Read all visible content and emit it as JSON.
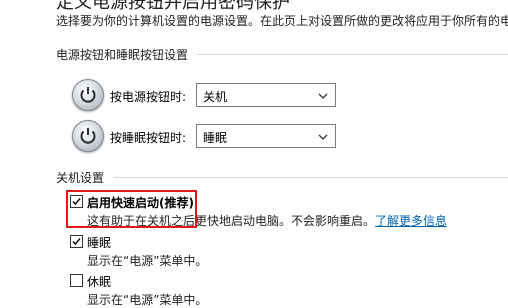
{
  "page": {
    "title": "定义电源按钮并启用密码保护",
    "description": "选择要为你的计算机设置的电源设置。在此页上对设置所做的更改将应用于你所有的电"
  },
  "buttons_section": {
    "heading": "电源按钮和睡眠按钮设置",
    "power_button": {
      "label": "按电源按钮时:",
      "value": "关机"
    },
    "sleep_button": {
      "label": "按睡眠按钮时:",
      "value": "睡眠"
    }
  },
  "shutdown_section": {
    "heading": "关机设置",
    "fast_startup": {
      "label": "启用快速启动(推荐)",
      "checked": true,
      "description": "这有助于在关机之后更快地启动电脑。不会影响重启。",
      "link": "了解更多信息"
    },
    "sleep": {
      "label": "睡眠",
      "checked": true,
      "description": "显示在“电源”菜单中。"
    },
    "hibernate": {
      "label": "休眠",
      "checked": false,
      "description": "显示在“电源”菜单中。"
    }
  },
  "icons": [
    "power-icon",
    "chevron-down-icon",
    "checkmark-icon"
  ],
  "colors": {
    "link": "#0063b1",
    "highlight": "#e0191b"
  }
}
